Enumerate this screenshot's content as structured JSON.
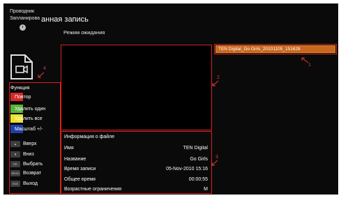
{
  "header": {
    "breadcrumb": "Проводник",
    "breadcrumb_sub": "Запланирова",
    "title": "анная запись",
    "status": "Режим ожидания"
  },
  "function_panel": {
    "title": "Функция",
    "color_keys": [
      {
        "color": "#d42a2a",
        "label": "Повтор"
      },
      {
        "color": "#58b13a",
        "label": "Удалить один"
      },
      {
        "color": "#e8e12b",
        "label": "Удалить все"
      },
      {
        "color": "#1f3fa8",
        "label": "Масштаб +/-"
      }
    ],
    "nav_keys": [
      {
        "key": "▲",
        "label": "Вверх"
      },
      {
        "key": "▼",
        "label": "Вниз"
      },
      {
        "key": "OK",
        "label": "Выбрать"
      },
      {
        "key": "Menu",
        "label": "Возврат"
      },
      {
        "key": "Exit",
        "label": "Выход"
      }
    ]
  },
  "file_info": {
    "title": "Информация о файле",
    "rows": [
      {
        "label": "Имя",
        "value": "TEN Digital"
      },
      {
        "label": "Название",
        "value": "Go Girls"
      },
      {
        "label": "Время записи",
        "value": "05-Nov-2010 15:16"
      },
      {
        "label": "Общее время",
        "value": "00:00:55"
      },
      {
        "label": "Возрастные ограничения",
        "value": "M"
      }
    ]
  },
  "file_list": [
    {
      "name": "TEN Digital_Go Girls_20101105_151628",
      "selected": true
    }
  ],
  "annotations": [
    "1",
    "2",
    "3",
    "4"
  ],
  "colors": {
    "annotation": "#d92121",
    "selected_item": "#c8681e"
  }
}
